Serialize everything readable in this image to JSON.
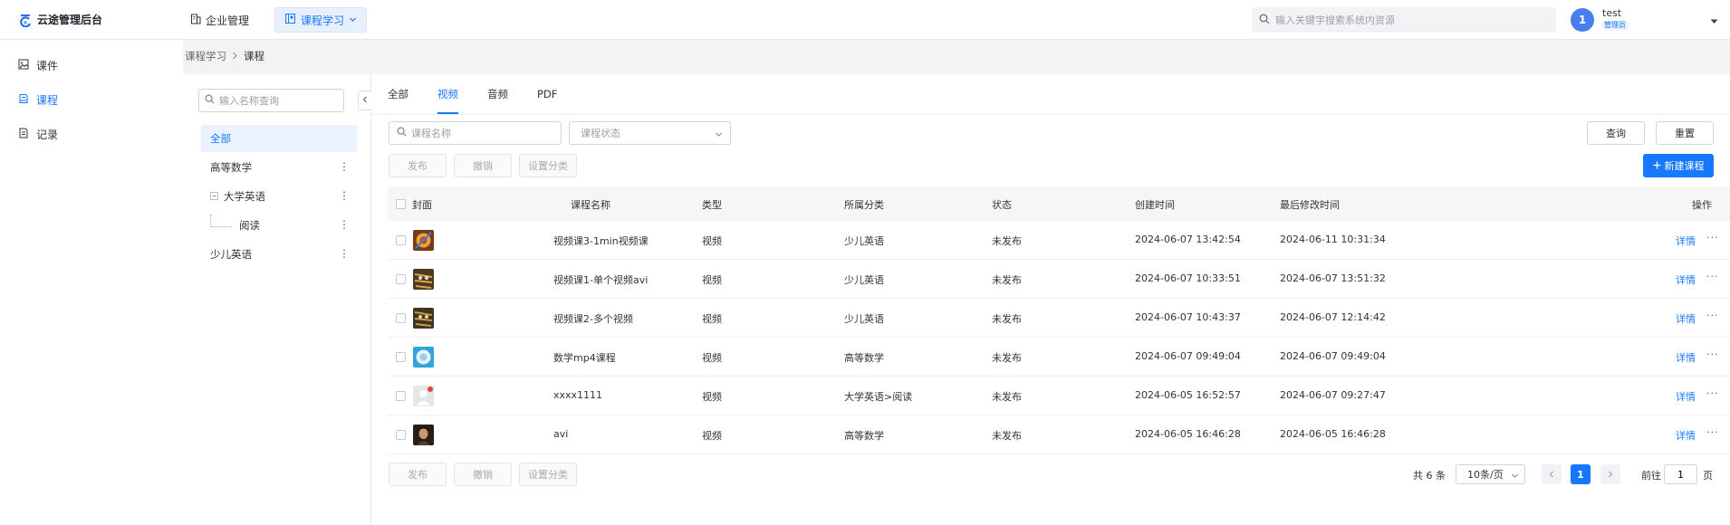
{
  "app": {
    "title": "云途管理后台"
  },
  "topnav": {
    "enterprise": "企业管理",
    "course_study": "课程学习"
  },
  "global_search": {
    "placeholder": "输入关键字搜索系统内资源"
  },
  "user": {
    "avatar_text": "1",
    "name": "test",
    "role": "管理员"
  },
  "sidebar": {
    "items": [
      {
        "label": "课件"
      },
      {
        "label": "课程"
      },
      {
        "label": "记录"
      }
    ]
  },
  "breadcrumb": {
    "parent": "课程学习",
    "current": "课程"
  },
  "category": {
    "search_placeholder": "输入名称查询",
    "items": [
      {
        "label": "全部"
      },
      {
        "label": "高等数学"
      },
      {
        "label": "大学英语"
      },
      {
        "label": "阅读"
      },
      {
        "label": "少儿英语"
      }
    ]
  },
  "tabs": [
    {
      "label": "全部"
    },
    {
      "label": "视频"
    },
    {
      "label": "音频"
    },
    {
      "label": "PDF"
    }
  ],
  "filters": {
    "name_placeholder": "课程名称",
    "status_placeholder": "课程状态"
  },
  "actions": {
    "query": "查询",
    "reset": "重置",
    "publish": "发布",
    "revoke": "撤销",
    "set_category": "设置分类",
    "new_course": "新建课程"
  },
  "table": {
    "headers": {
      "cover": "封面",
      "name": "课程名称",
      "type": "类型",
      "category": "所属分类",
      "status": "状态",
      "created": "创建时间",
      "modified": "最后修改时间",
      "ops": "操作"
    },
    "rows": [
      {
        "name": "视频课3-1min视频课",
        "type": "视频",
        "category": "少儿英语",
        "status": "未发布",
        "created": "2024-06-07 13:42:54",
        "modified": "2024-06-11 10:31:34",
        "detail": "详情",
        "more": "···"
      },
      {
        "name": "视频课1-单个视频avi",
        "type": "视频",
        "category": "少儿英语",
        "status": "未发布",
        "created": "2024-06-07 10:33:51",
        "modified": "2024-06-07 13:51:32",
        "detail": "详情",
        "more": "···"
      },
      {
        "name": "视频课2-多个视频",
        "type": "视频",
        "category": "少儿英语",
        "status": "未发布",
        "created": "2024-06-07 10:43:37",
        "modified": "2024-06-07 12:14:42",
        "detail": "详情",
        "more": "···"
      },
      {
        "name": "数学mp4课程",
        "type": "视频",
        "category": "高等数学",
        "status": "未发布",
        "created": "2024-06-07 09:49:04",
        "modified": "2024-06-07 09:49:04",
        "detail": "详情",
        "more": "···"
      },
      {
        "name": "xxxx1111",
        "type": "视频",
        "category": "大学英语>阅读",
        "status": "未发布",
        "created": "2024-06-05 16:52:57",
        "modified": "2024-06-07 09:27:47",
        "detail": "详情",
        "more": "···"
      },
      {
        "name": "avi",
        "type": "视频",
        "category": "高等数学",
        "status": "未发布",
        "created": "2024-06-05 16:46:28",
        "modified": "2024-06-05 16:46:28",
        "detail": "详情",
        "more": "···"
      }
    ]
  },
  "pagination": {
    "total": "共 6 条",
    "page_size": "10条/页",
    "current": "1",
    "goto_prefix": "前往",
    "goto_value": "1",
    "goto_suffix": "页"
  },
  "colors": {
    "accent": "#1677ff",
    "sidebar_bg": "#ffffff",
    "page_bg": "#f2f3f5"
  }
}
